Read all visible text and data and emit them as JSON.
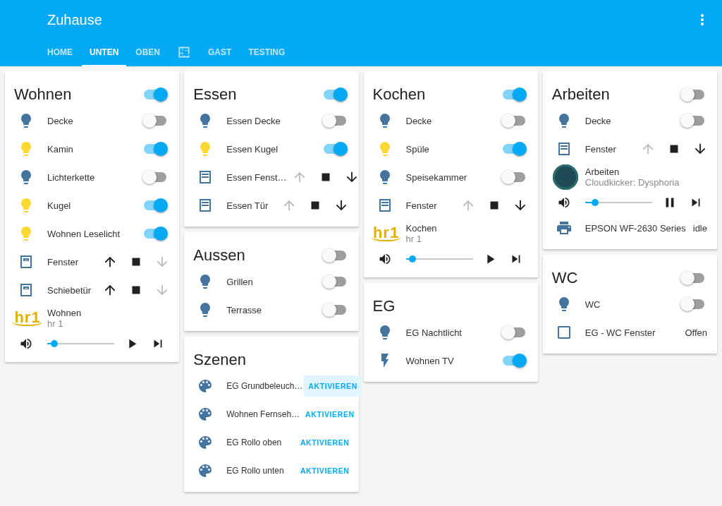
{
  "header": {
    "title": "Zuhause"
  },
  "tabs": [
    {
      "kind": "text",
      "label": "HOME",
      "selected": false
    },
    {
      "kind": "text",
      "label": "UNTEN",
      "selected": true
    },
    {
      "kind": "text",
      "label": "OBEN",
      "selected": false
    },
    {
      "kind": "floorplan",
      "selected": false
    },
    {
      "kind": "text",
      "label": "GAST",
      "selected": false
    },
    {
      "kind": "text",
      "label": "TESTING",
      "selected": false
    }
  ],
  "columns": [
    {
      "cards": [
        {
          "title": "Wohnen",
          "toggle": {
            "on": true
          },
          "rows": [
            {
              "kind": "light",
              "name": "Decke",
              "on": false
            },
            {
              "kind": "light",
              "name": "Kamin",
              "on": true
            },
            {
              "kind": "light",
              "name": "Lichterkette",
              "on": false
            },
            {
              "kind": "light",
              "name": "Kugel",
              "on": true
            },
            {
              "kind": "light",
              "name": "Wohnen Leselicht",
              "on": true
            },
            {
              "kind": "shutter",
              "name": "Fenster",
              "up_enabled": true,
              "down_enabled": false
            },
            {
              "kind": "shutter",
              "name": "Schiebetür",
              "up_enabled": true,
              "down_enabled": false
            },
            {
              "kind": "radio",
              "logo_text": "hr1",
              "title": "Wohnen",
              "subtitle": "hr 1",
              "level": 0.1,
              "playing": false
            }
          ]
        }
      ]
    },
    {
      "cards": [
        {
          "title": "Essen",
          "toggle": {
            "on": true
          },
          "rows": [
            {
              "kind": "light",
              "name": "Essen Decke",
              "on": false
            },
            {
              "kind": "light",
              "name": "Essen Kugel",
              "on": true
            },
            {
              "kind": "blind",
              "name": "Essen Fenst…",
              "up_enabled": false,
              "down_enabled": true
            },
            {
              "kind": "blind",
              "name": "Essen Tür",
              "up_enabled": false,
              "down_enabled": true
            }
          ]
        },
        {
          "title": "Aussen",
          "toggle": {
            "on": false
          },
          "rows": [
            {
              "kind": "light",
              "name": "Grillen",
              "on": false
            },
            {
              "kind": "light",
              "name": "Terrasse",
              "on": false
            }
          ]
        },
        {
          "title": "Szenen",
          "rows": [
            {
              "kind": "scene",
              "name": "EG Grundbeleuch…",
              "action": "AKTIVIEREN",
              "highlighted": true
            },
            {
              "kind": "scene",
              "name": "Wohnen Fernseh…",
              "action": "AKTIVIEREN",
              "highlighted": false
            },
            {
              "kind": "scene",
              "name": "EG Rollo oben",
              "action": "AKTIVIEREN",
              "highlighted": false
            },
            {
              "kind": "scene",
              "name": "EG Rollo unten",
              "action": "AKTIVIEREN",
              "highlighted": false
            }
          ]
        }
      ]
    },
    {
      "cards": [
        {
          "title": "Kochen",
          "toggle": {
            "on": true
          },
          "rows": [
            {
              "kind": "light",
              "name": "Decke",
              "on": false
            },
            {
              "kind": "light",
              "name": "Spüle",
              "on": true
            },
            {
              "kind": "light",
              "name": "Speisekammer",
              "on": false
            },
            {
              "kind": "blind",
              "name": "Fenster",
              "up_enabled": false,
              "down_enabled": true
            },
            {
              "kind": "radio",
              "logo_text": "hr1",
              "title": "Kochen",
              "subtitle": "hr 1",
              "level": 0.1,
              "playing": false
            }
          ]
        },
        {
          "title": "EG",
          "rows": [
            {
              "kind": "light",
              "name": "EG Nachtlicht",
              "on": false
            },
            {
              "kind": "switch",
              "name": "Wohnen TV",
              "on": true
            }
          ]
        }
      ]
    },
    {
      "cards": [
        {
          "title": "Arbeiten",
          "toggle": {
            "on": false
          },
          "rows": [
            {
              "kind": "light",
              "name": "Decke",
              "on": false
            },
            {
              "kind": "blind",
              "name": "Fenster",
              "up_enabled": false,
              "down_enabled": true
            },
            {
              "kind": "music",
              "title": "Arbeiten",
              "subtitle": "Cloudkicker: Dysphoria",
              "level": 0.15,
              "playing": true
            },
            {
              "kind": "printer",
              "name": "EPSON WF-2630 Series",
              "state": "idle"
            }
          ]
        },
        {
          "title": "WC",
          "toggle": {
            "on": false
          },
          "rows": [
            {
              "kind": "light",
              "name": "WC",
              "on": false
            },
            {
              "kind": "contact",
              "name": "EG - WC Fenster",
              "state": "Offen"
            }
          ]
        }
      ]
    }
  ]
}
